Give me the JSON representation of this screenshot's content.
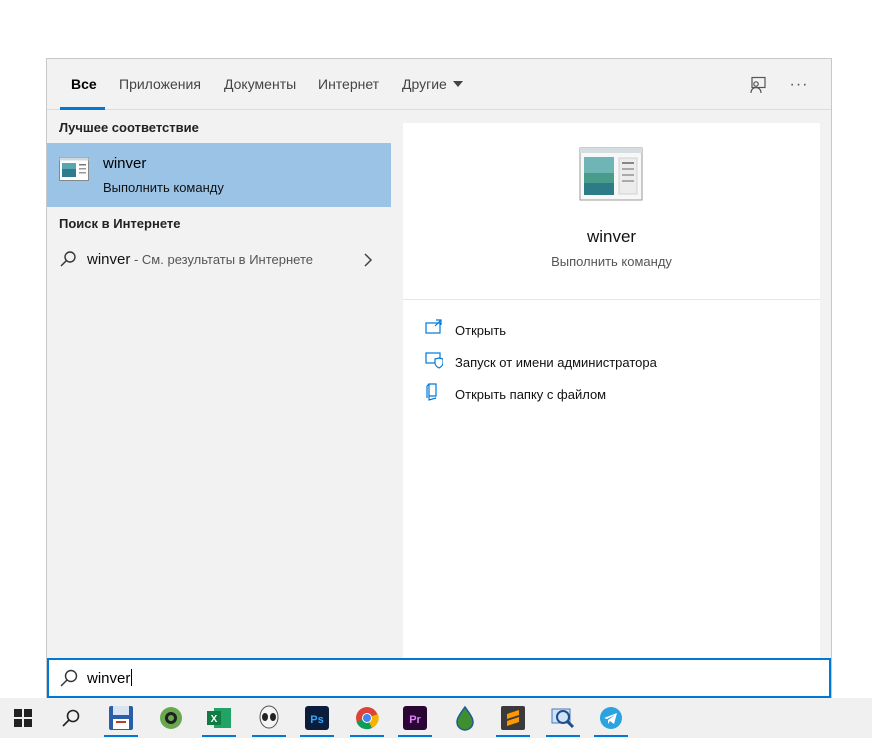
{
  "tabs": [
    {
      "label": "Все",
      "active": true
    },
    {
      "label": "Приложения"
    },
    {
      "label": "Документы"
    },
    {
      "label": "Интернет"
    },
    {
      "label": "Другие",
      "has_dropdown": true
    }
  ],
  "toolbar": {
    "feedback_icon": "feedback-icon",
    "more_label": "···"
  },
  "left": {
    "best_match_title": "Лучшее соответствие",
    "best_match": {
      "name": "winver",
      "subtitle": "Выполнить команду",
      "icon": "winver-app-icon"
    },
    "web_title": "Поиск в Интернете",
    "web_result": {
      "query": "winver",
      "hint": " - См. результаты в Интернете"
    }
  },
  "preview": {
    "name": "winver",
    "subtitle": "Выполнить команду",
    "actions": [
      {
        "label": "Открыть",
        "icon": "open-icon"
      },
      {
        "label": "Запуск от имени администратора",
        "icon": "run-as-admin-icon"
      },
      {
        "label": "Открыть папку с файлом",
        "icon": "open-folder-icon"
      }
    ]
  },
  "search": {
    "value": "winver"
  },
  "taskbar": {
    "apps": [
      "start",
      "search",
      "floppy-app",
      "recycle-app",
      "excel",
      "alien-app",
      "photoshop",
      "chrome",
      "premiere",
      "droplet-app",
      "sublime-text",
      "magnifier-app",
      "telegram"
    ]
  },
  "colors": {
    "accent": "#0078d7",
    "selection": "#9ac3e6",
    "pane_bg": "#f2f2f2"
  }
}
